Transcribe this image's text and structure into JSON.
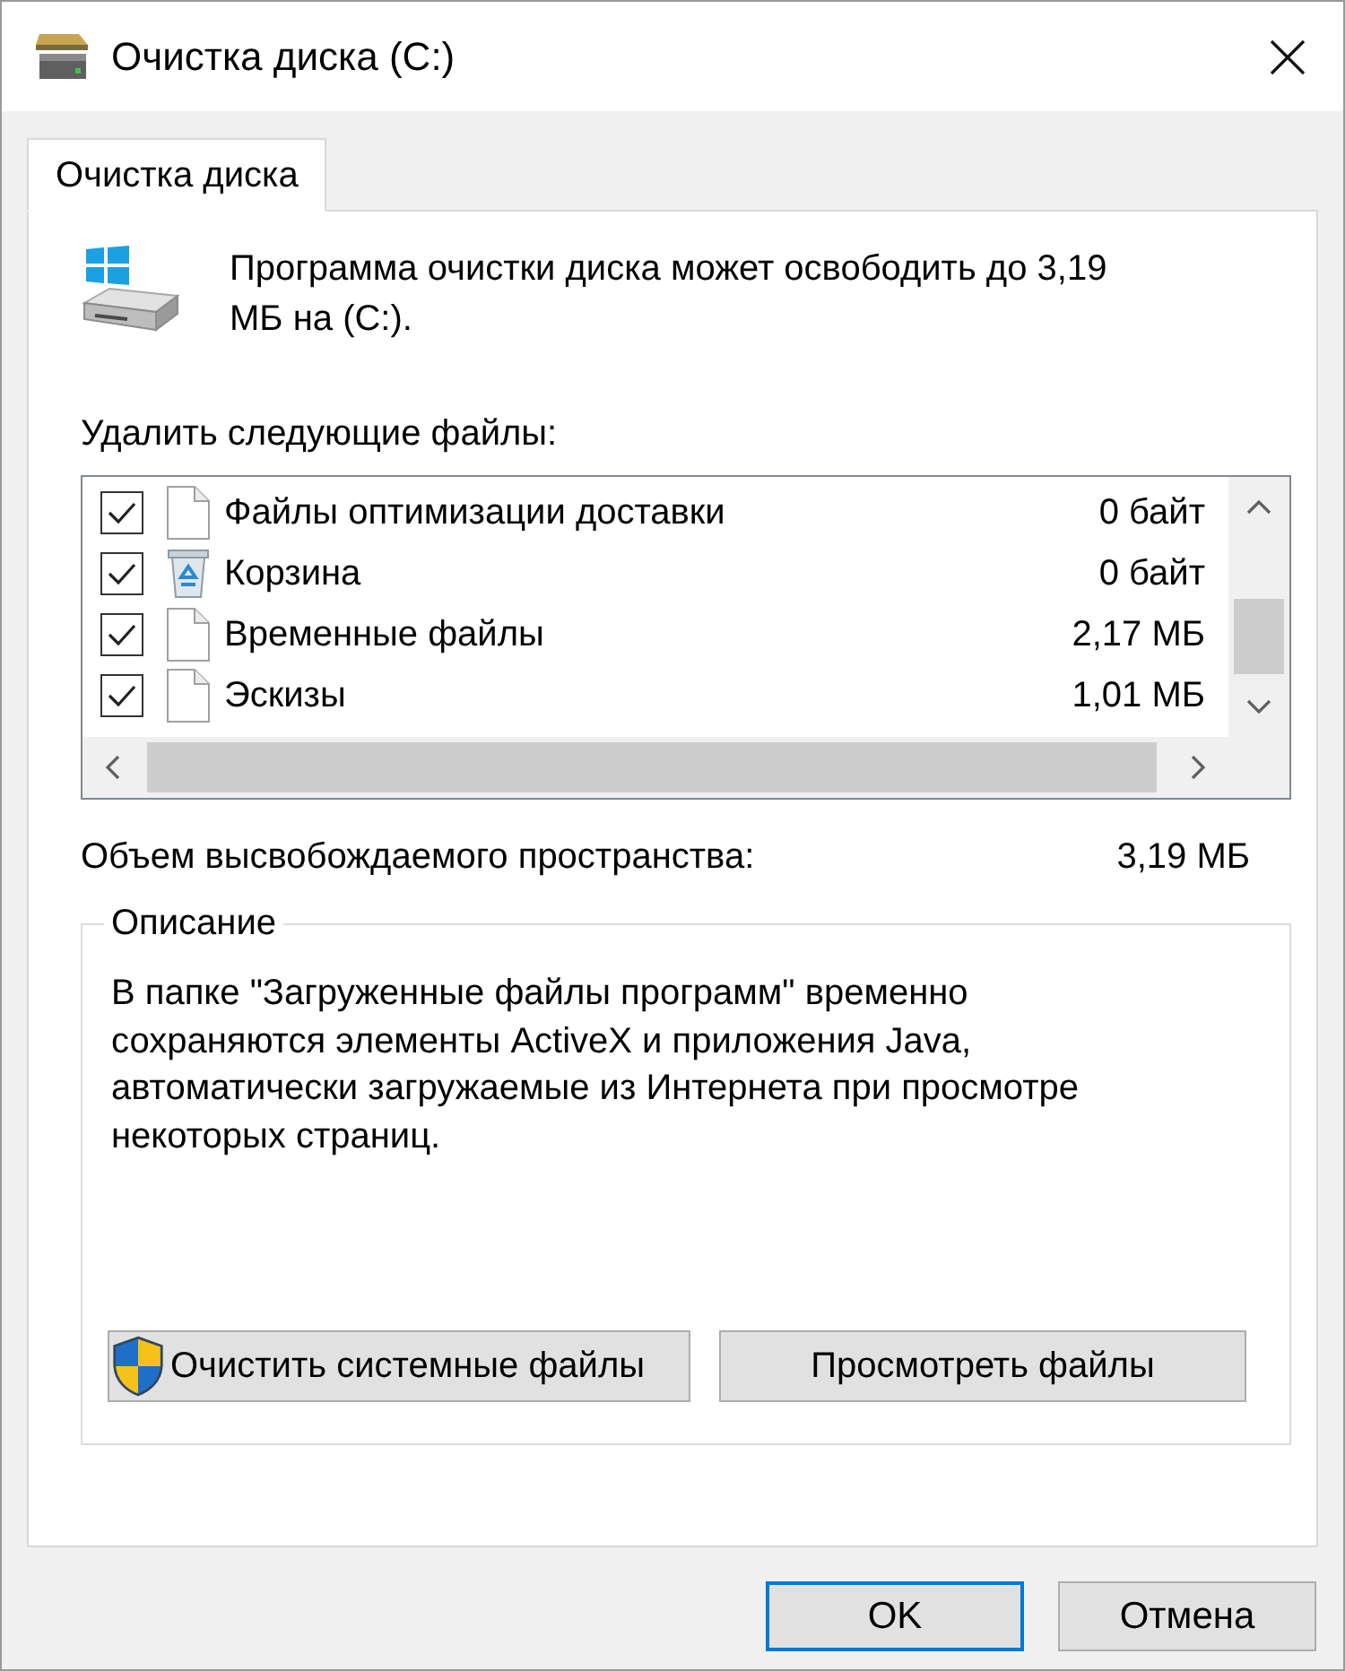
{
  "window": {
    "title": "Очистка диска (C:)"
  },
  "tabs": [
    {
      "label": "Очистка диска",
      "selected": true
    }
  ],
  "summary": {
    "text": "Программа очистки диска может освободить до 3,19 МБ на (C:)."
  },
  "files": {
    "label": "Удалить следующие файлы:",
    "items": [
      {
        "kind": "document",
        "name": "Файлы оптимизации доставки",
        "size": "0 байт",
        "checked": true
      },
      {
        "kind": "recycle-bin",
        "name": "Корзина",
        "size": "0 байт",
        "checked": true
      },
      {
        "kind": "document",
        "name": "Временные файлы",
        "size": "2,17 МБ",
        "checked": true
      },
      {
        "kind": "document",
        "name": "Эскизы",
        "size": "1,01 МБ",
        "checked": true
      }
    ]
  },
  "total": {
    "label": "Объем высвобождаемого пространства:",
    "value": "3,19 МБ"
  },
  "description": {
    "title": "Описание",
    "text": "В папке \"Загруженные файлы программ\" временно сохраняются элементы ActiveX и приложения Java, автоматически загружаемые из Интернета при просмотре некоторых страниц.",
    "buttons": [
      {
        "kind": "shield",
        "label": "Очистить системные файлы"
      },
      {
        "kind": "plain",
        "label": "Просмотреть файлы"
      }
    ]
  },
  "dialog_buttons": [
    {
      "label": "OK",
      "default": true
    },
    {
      "label": "Отмена",
      "default": false
    }
  ]
}
